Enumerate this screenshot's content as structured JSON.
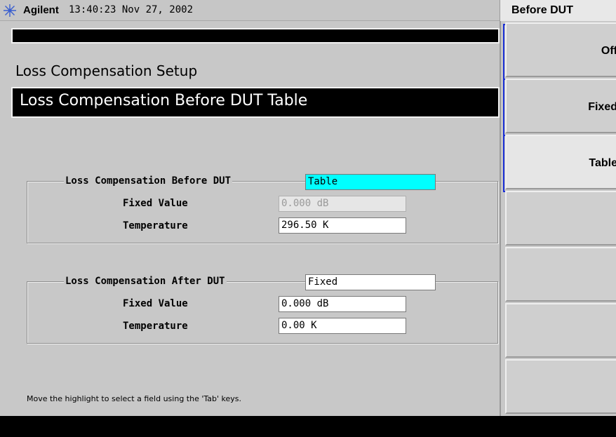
{
  "header": {
    "brand": "Agilent",
    "timestamp": "13:40:23  Nov 27, 2002",
    "menu_title": "Before DUT",
    "logo_icon": "agilent-spark-icon"
  },
  "main": {
    "setup_title": "Loss Compensation Setup",
    "table_title": "Loss Compensation Before DUT Table",
    "hint": "Move the highlight to select a field using the 'Tab' keys."
  },
  "before_group": {
    "label": "Loss Compensation Before DUT",
    "mode": "Table",
    "fixed_label": "Fixed Value",
    "fixed_value": "0.000 dB",
    "temp_label": "Temperature",
    "temp_value": "296.50 K"
  },
  "after_group": {
    "label": "Loss Compensation After DUT",
    "mode": "Fixed",
    "fixed_label": "Fixed Value",
    "fixed_value": "0.000 dB",
    "temp_label": "Temperature",
    "temp_value": "0.00 K"
  },
  "softkeys": [
    {
      "label": "Off"
    },
    {
      "label": "Fixed"
    },
    {
      "label": "Table"
    },
    {
      "label": ""
    },
    {
      "label": ""
    },
    {
      "label": ""
    },
    {
      "label": ""
    }
  ],
  "colors": {
    "highlight": "#00ffff",
    "bracket": "#1a2fd6",
    "background": "#c8c8c8"
  }
}
